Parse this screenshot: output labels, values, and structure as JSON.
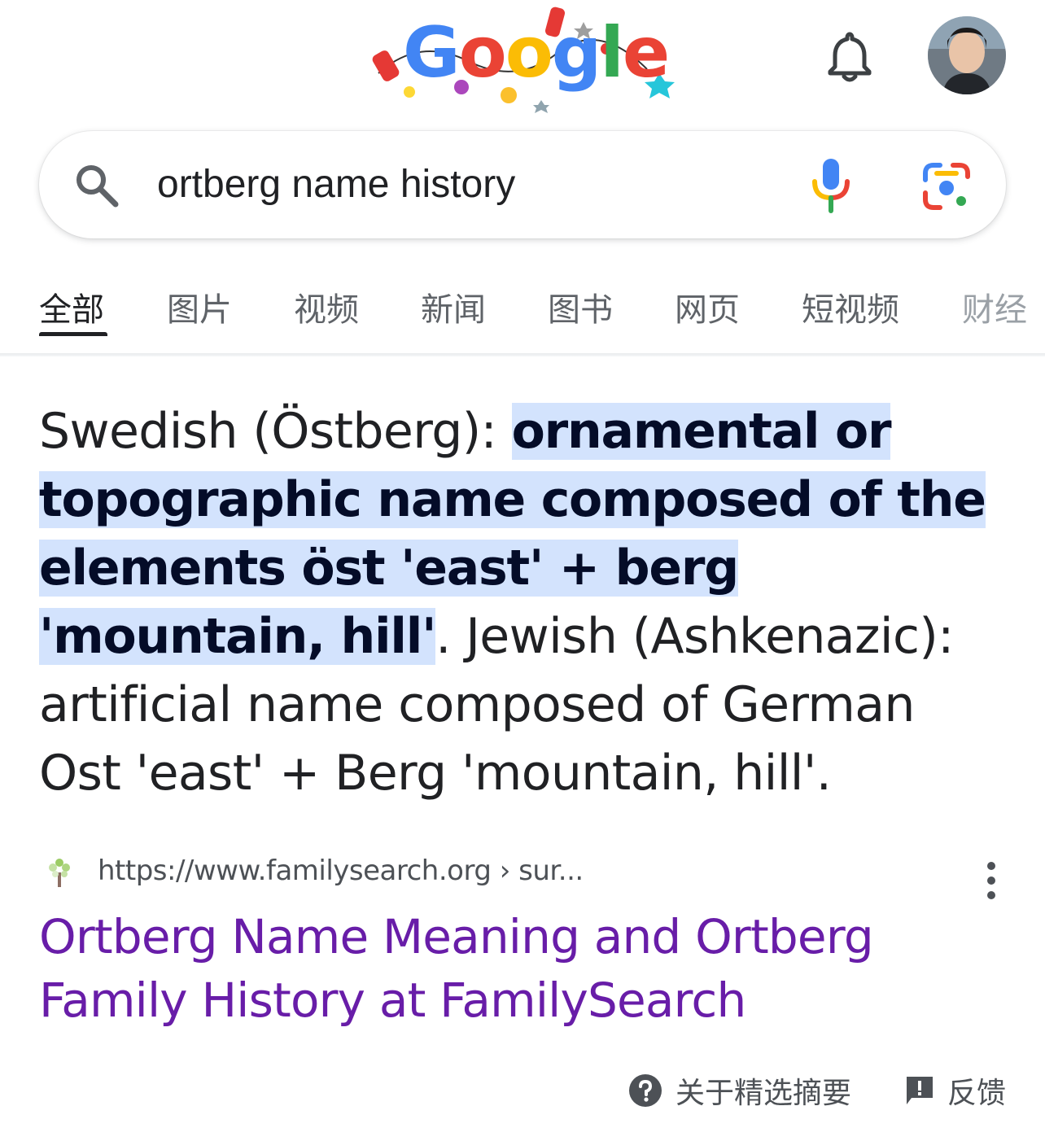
{
  "header": {
    "logo_text": "Google",
    "notifications_icon": "bell-icon",
    "avatar_icon": "user-avatar"
  },
  "search": {
    "query": "ortberg name history",
    "search_icon": "search-icon",
    "voice_icon": "mic-icon",
    "lens_icon": "camera-lens-icon"
  },
  "tabs": [
    {
      "label": "全部",
      "active": true
    },
    {
      "label": "图片"
    },
    {
      "label": "视频"
    },
    {
      "label": "新闻"
    },
    {
      "label": "图书"
    },
    {
      "label": "网页"
    },
    {
      "label": "短视频"
    },
    {
      "label": "财经"
    }
  ],
  "snippet": {
    "prefix": "Swedish (Östberg): ",
    "highlighted": "ornamental or topographic name composed of the elements öst 'east' + berg 'mountain, hill'",
    "suffix": ". Jewish (Ashkenazic): artificial name composed of German Ost 'east' + Berg 'mountain, hill'."
  },
  "result": {
    "url": "https://www.familysearch.org › sur...",
    "title": "Ortberg Name Meaning and Ortberg Family History at FamilySearch",
    "favicon_icon": "familysearch-tree-icon",
    "more_icon": "more-vert-icon"
  },
  "footer": {
    "about_label": "关于精选摘要",
    "feedback_label": "反馈"
  },
  "colors": {
    "highlight": "#d3e3fd",
    "link_visited": "#681da8",
    "text": "#202124",
    "secondary_text": "#4d5156"
  }
}
